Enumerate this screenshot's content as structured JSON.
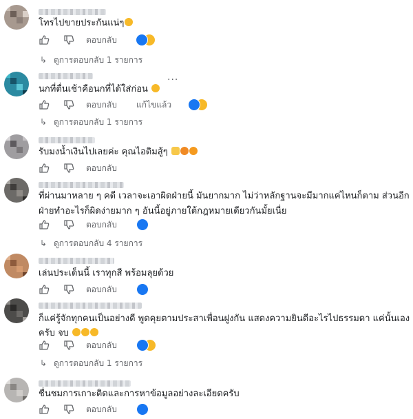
{
  "labels": {
    "reply": "ตอบกลับ",
    "edited": "แก้ไขแล้ว"
  },
  "icons": {
    "like": "thumbs-up-icon",
    "dislike": "thumbs-down-icon",
    "replies_arrow": "reply-arrow-icon",
    "more": "more-options-icon"
  },
  "colors": {
    "like_blue": "#1877f2",
    "haha_yellow": "#f7b928",
    "love_red": "#f33e58"
  },
  "comments": [
    {
      "text": "โทรไปขายประกันแน่ๆ",
      "emojis": [
        "😂"
      ],
      "reactions": [
        "like",
        "haha"
      ],
      "replies": "ดูการตอบกลับ 1 รายการ"
    },
    {
      "text": "นกที่ตื่นเช้าคือนกที่ได้ใส่ก่อน",
      "emojis": [
        "😄"
      ],
      "edited": "แก้ไขแล้ว",
      "reactions": [
        "like",
        "haha"
      ],
      "replies": "ดูการตอบกลับ 1 รายการ"
    },
    {
      "text": "รับมงน้ำเงินไปเลยค่ะ คุณไอติมสู้ๆ",
      "emojis": [
        "✌",
        "🧡",
        "🍊"
      ],
      "reactions": []
    },
    {
      "text_lines": [
        "ที่ผ่านมาหลาย ๆ คดี เวลาจะเอาผิดฝ่ายนี้ มันยากมาก ไม่ว่าหลักฐานจะมีมากแค่ไหนก็ตาม ส่วนอีก",
        "ฝ่ายทำอะไรก็ผิดง่ายมาก ๆ อันนี้อยู่ภายใต้กฎหมายเดียวกันมั้ยเนี่ย"
      ],
      "reactions": [
        "like"
      ],
      "replies": "ดูการตอบกลับ 4 รายการ"
    },
    {
      "text": "เล่นประเด็นนี้ เราทุกสี พร้อมลุยด้วย",
      "reactions": [
        "like"
      ]
    },
    {
      "text_lines": [
        "ก็แค่รู้จักทุกคนเป็นอย่างดี พูดคุยตามประสาเพื่อนฝูงกัน แสดงความยินดีอะไรไปธรรมดา แค่นั้นเอง",
        "ครับ จบ"
      ],
      "emojis": [
        "😂",
        "😂",
        "😂"
      ],
      "reactions": [
        "like",
        "haha"
      ],
      "replies": "ดูการตอบกลับ 1 รายการ"
    },
    {
      "text": "ชื่นชมการเกาะติดและการหาข้อมูลอย่างละเอียดครับ",
      "reactions": [
        "like"
      ]
    }
  ]
}
